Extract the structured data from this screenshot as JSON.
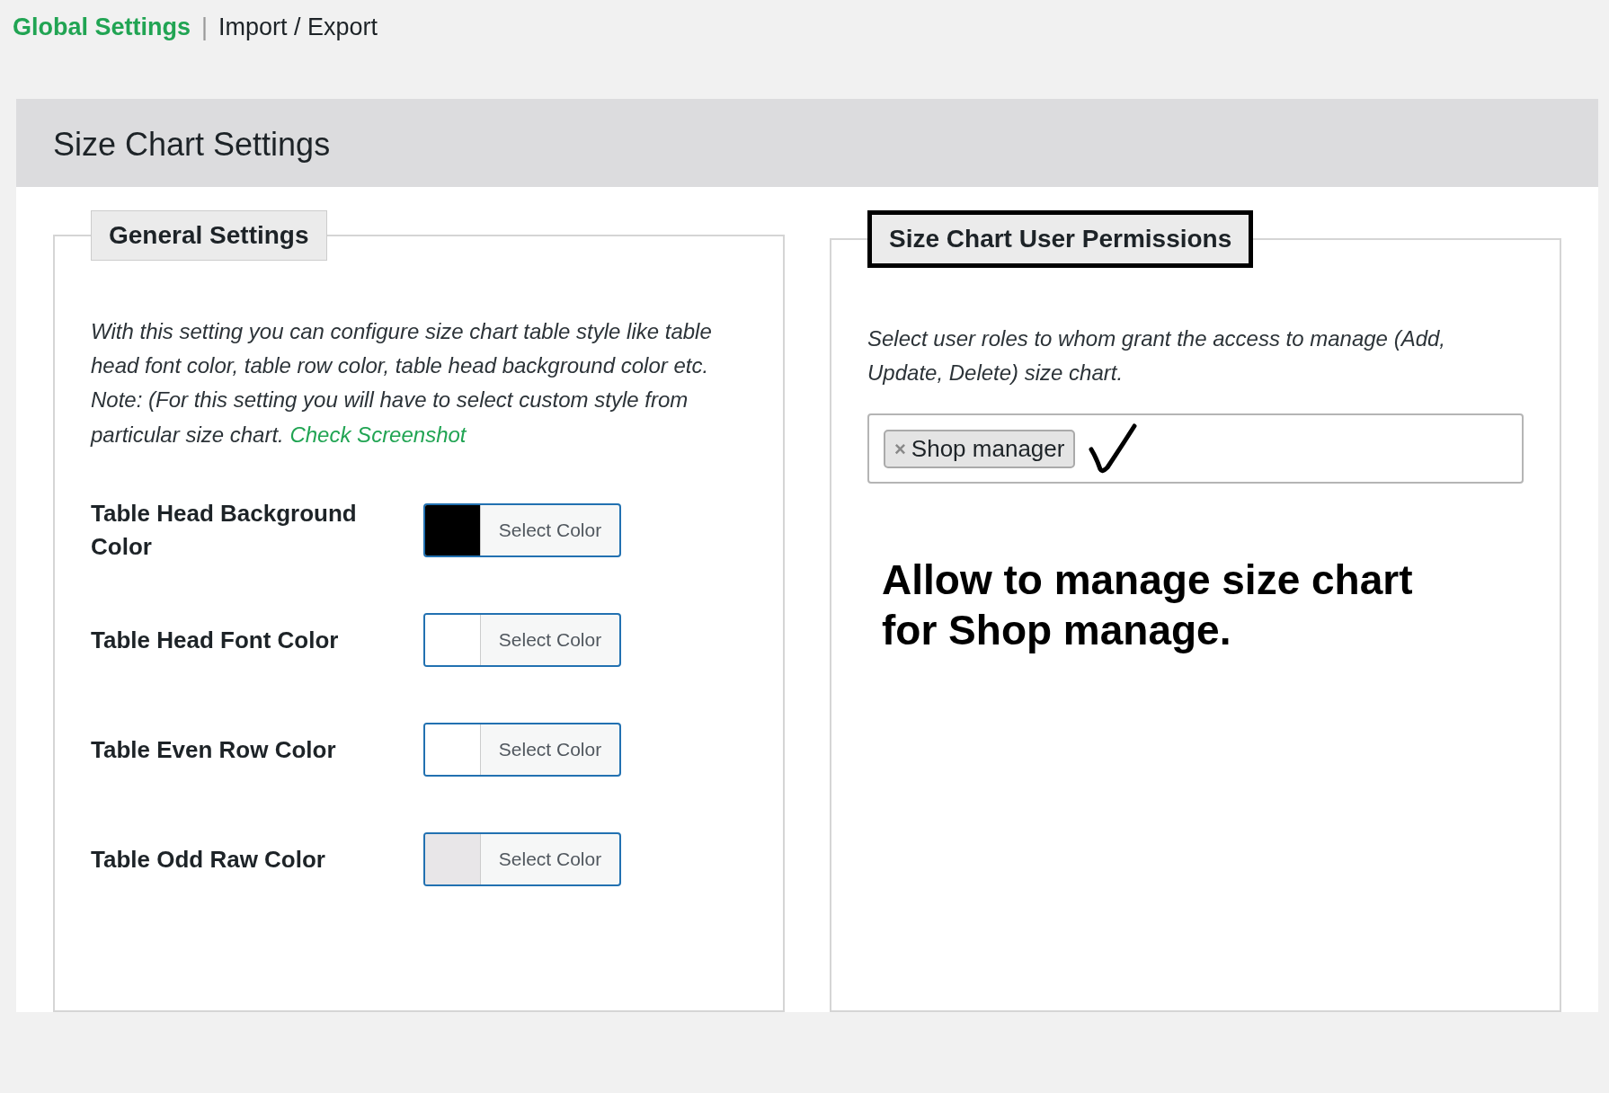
{
  "nav": {
    "separator": "|",
    "items": [
      {
        "label": "Global Settings",
        "selected": true
      },
      {
        "label": "Import / Export",
        "selected": false
      }
    ]
  },
  "panel": {
    "title": "Size Chart Settings"
  },
  "general": {
    "legend": "General Settings",
    "description": "With this setting you can configure size chart table style like table head font color, table row color, table head background color etc. Note: (For this setting you will have to select custom style from particular size chart.",
    "link": "Check Screenshot",
    "colors": [
      {
        "label": "Table Head Background Color",
        "color": "#000000",
        "button": "Select Color"
      },
      {
        "label": "Table Head Font Color",
        "color": "#ffffff",
        "button": "Select Color"
      },
      {
        "label": "Table Even Row Color",
        "color": "#ffffff",
        "button": "Select Color"
      },
      {
        "label": "Table Odd Raw Color",
        "color": "#e8e6e8",
        "button": "Select Color"
      }
    ]
  },
  "permissions": {
    "legend": "Size Chart User Permissions",
    "highlighted": true,
    "description": "Select user roles to whom grant the access to manage (Add, Update, Delete) size chart.",
    "tags": [
      {
        "remove": "×",
        "label": "Shop manager"
      }
    ]
  },
  "annotation": {
    "text": "Allow to manage size chart for Shop manage."
  }
}
